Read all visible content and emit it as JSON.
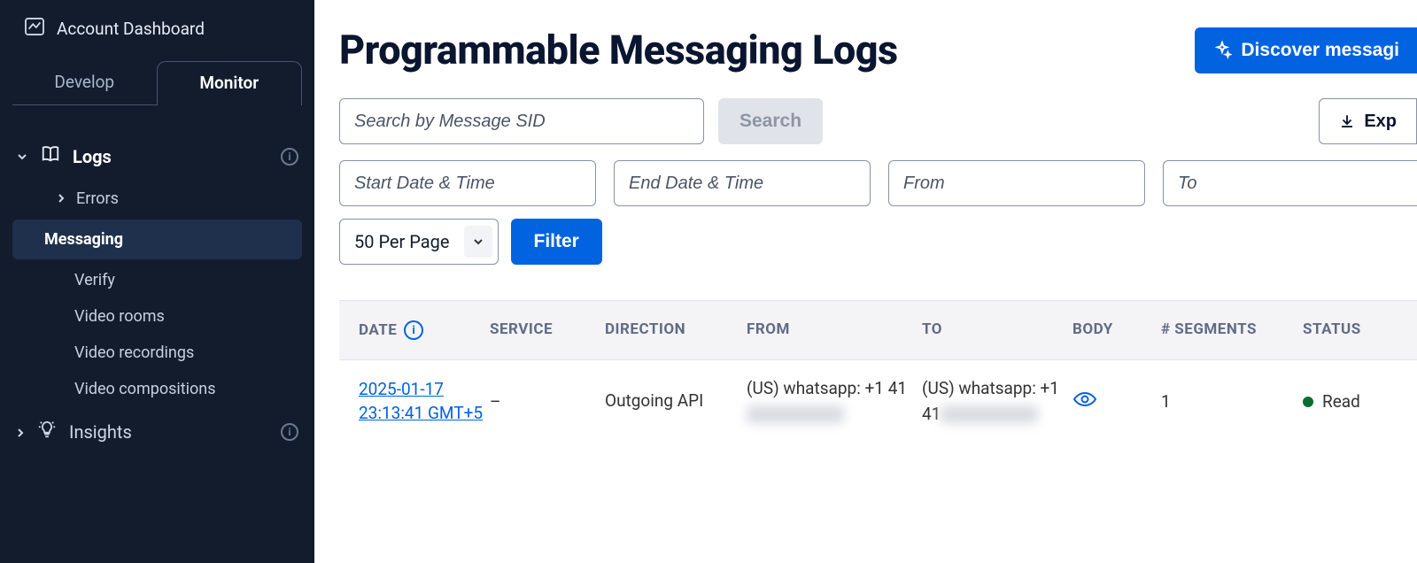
{
  "sidebar": {
    "account_label": "Account Dashboard",
    "tabs": {
      "develop": "Develop",
      "monitor": "Monitor"
    },
    "groups": {
      "logs": {
        "label": "Logs"
      },
      "insights": {
        "label": "Insights"
      }
    },
    "logs_children": {
      "errors": "Errors",
      "messaging": "Messaging",
      "verify": "Verify",
      "video_rooms": "Video rooms",
      "video_recordings": "Video recordings",
      "video_compositions": "Video compositions"
    }
  },
  "header": {
    "title": "Programmable Messaging Logs",
    "discover_label": "Discover messagi"
  },
  "filters": {
    "sid_placeholder": "Search by Message SID",
    "search_label": "Search",
    "export_label": "Exp",
    "start_placeholder": "Start Date & Time",
    "end_placeholder": "End Date & Time",
    "from_placeholder": "From",
    "to_placeholder": "To",
    "per_page_label": "50 Per Page",
    "filter_label": "Filter"
  },
  "table": {
    "columns": {
      "date": "DATE",
      "service": "SERVICE",
      "direction": "DIRECTION",
      "from": "FROM",
      "to": "TO",
      "body": "BODY",
      "segments": "# SEGMENTS",
      "status": "STATUS"
    },
    "rows": [
      {
        "date": "2025-01-17 23:13:41 GMT+5",
        "service": "–",
        "direction": "Outgoing API",
        "from_prefix": "(US) whatsapp: +1 41",
        "to_prefix": "(US) whatsapp:  +1 41",
        "segments": "1",
        "status": "Read"
      }
    ]
  }
}
